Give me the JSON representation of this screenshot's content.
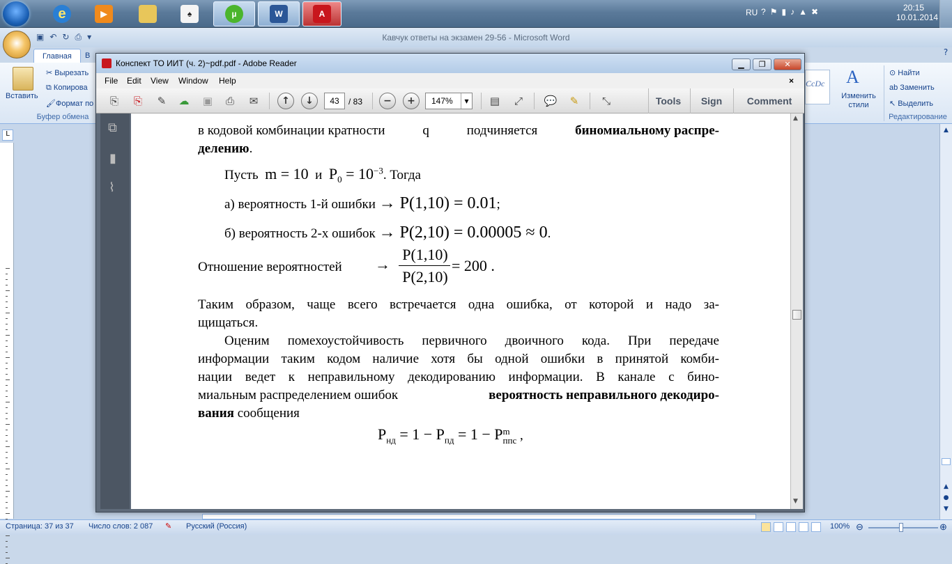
{
  "taskbar": {
    "lang": "RU",
    "time": "20:15",
    "date": "10.01.2014",
    "apps": [
      "internet-explorer",
      "media-player",
      "file-explorer",
      "solitaire",
      "utorrent",
      "word",
      "adobe-reader"
    ]
  },
  "word": {
    "title": "Кавчук ответы на экзамен 29-56 - Microsoft Word",
    "tab_home": "Главная",
    "tab_b": "В",
    "paste": "Вставить",
    "cut": "Вырезать",
    "copy": "Копирова",
    "format": "Формат по",
    "clipboard_group": "Буфер обмена",
    "styles_preview": "CcDc",
    "change_styles": "Изменить стили",
    "find": "Найти",
    "replace": "Заменить",
    "select": "Выделить",
    "editing_group": "Редактирование",
    "status_page": "Страница: 37 из 37",
    "status_words": "Число слов: 2 087",
    "status_lang": "Русский (Россия)",
    "zoom": "100%"
  },
  "reader": {
    "title": "Конспект ТО ИИТ (ч. 2)~pdf.pdf - Adobe Reader",
    "menu": [
      "File",
      "Edit",
      "View",
      "Window",
      "Help"
    ],
    "page_current": "43",
    "page_total": "/ 83",
    "zoom": "147%",
    "tools": "Tools",
    "sign": "Sign",
    "comment": "Comment"
  },
  "doc": {
    "line1a": "в кодовой комбинации кратности ",
    "line1q": "q",
    "line1b": " подчиняется ",
    "line1bold": "биномиальному распре-",
    "line2bold": "делению",
    "line2end": ".",
    "let_prefix": "Пусть",
    "let_m": "m = 10",
    "let_and": "и",
    "let_p": "P",
    "let_p_sub": "0",
    "let_eq": " = 10",
    "let_exp": "−3",
    "let_then": ". Тогда",
    "a_text": "а) вероятность 1-й ошибки",
    "a_formula": "→ P(1,10) = 0.01",
    "a_end": ";",
    "b_text": "б) вероятность 2-х ошибок",
    "b_formula": "→ P(2,10) = 0.00005 ≈ 0",
    "b_end": ".",
    "ratio_text": "Отношение вероятностей",
    "ratio_arrow": "→",
    "ratio_num": "P(1,10)",
    "ratio_den": "P(2,10)",
    "ratio_res": "= 200",
    "ratio_end": ".",
    "para1_l1": "Таким образом, чаще всего встречается одна ошибка, от которой и надо за-",
    "para1_l2": "щищаться.",
    "para2_l1": "Оценим помехоустойчивость первичного двоичного кода. При передаче",
    "para2_l2": "информации таким кодом наличие хотя бы одной ошибки в принятой комби-",
    "para2_l3": "нации ведет к неправильному декодированию информации. В канале с бино-",
    "para2_l4a": "миальным распределением ошибок ",
    "para2_l4bold": "вероятность неправильного декодиро-",
    "para2_l5bold": "вания",
    "para2_l5end": " сообщения",
    "f_p": "P",
    "f_nd": "нд",
    "f_mid": " = 1 − P",
    "f_pd": "пд",
    "f_mid2": " = 1 − P",
    "f_m": "m",
    "f_pps": "ппс",
    "f_end": " ,"
  }
}
